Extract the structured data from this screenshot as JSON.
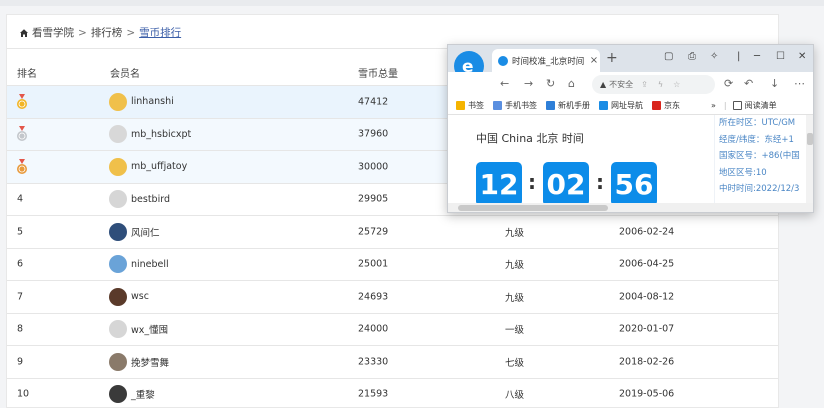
{
  "breadcrumb": {
    "home": "看雪学院",
    "sep": ">",
    "level2": "排行榜",
    "current": "雪币排行"
  },
  "table": {
    "headers": {
      "rank": "排名",
      "member": "会员名",
      "coins": "雪币总量"
    },
    "rows": [
      {
        "rank": "",
        "medal": "gold",
        "avatar": "#f0c04a",
        "name": "linhanshi",
        "coins": "47412",
        "level": "",
        "date": ""
      },
      {
        "rank": "",
        "medal": "silver",
        "avatar": "#d8d8d8",
        "name": "mb_hsbicxpt",
        "coins": "37960",
        "level": "",
        "date": ""
      },
      {
        "rank": "",
        "medal": "bronze",
        "avatar": "#f0c04a",
        "name": "mb_uffjatoy",
        "coins": "30000",
        "level": "",
        "date": ""
      },
      {
        "rank": "4",
        "medal": "",
        "avatar": "#d6d6d6",
        "name": "bestbird",
        "coins": "29905",
        "level": "",
        "date": ""
      },
      {
        "rank": "5",
        "medal": "",
        "avatar": "#2f4e7a",
        "name": "风间仁",
        "coins": "25729",
        "level": "九级",
        "date": "2006-02-24"
      },
      {
        "rank": "6",
        "medal": "",
        "avatar": "#6aa3d8",
        "name": "ninebell",
        "coins": "25001",
        "level": "九级",
        "date": "2006-04-25"
      },
      {
        "rank": "7",
        "medal": "",
        "avatar": "#5a3a2a",
        "name": "wsc",
        "coins": "24693",
        "level": "九级",
        "date": "2004-08-12"
      },
      {
        "rank": "8",
        "medal": "",
        "avatar": "#d6d6d6",
        "name": "wx_懂囤",
        "coins": "24000",
        "level": "一级",
        "date": "2020-01-07"
      },
      {
        "rank": "9",
        "medal": "",
        "avatar": "#8a7a6a",
        "name": "挽梦雪舞",
        "coins": "23330",
        "level": "七级",
        "date": "2018-02-26"
      },
      {
        "rank": "10",
        "medal": "",
        "avatar": "#3a3a3a",
        "name": "_重黎",
        "coins": "21593",
        "level": "八级",
        "date": "2019-05-06"
      }
    ]
  },
  "browser": {
    "tab_title": "时间校准_北京时间",
    "tab_close": "×",
    "new_tab": "+",
    "url_warning": "不安全",
    "bookmarks": [
      {
        "label": "书签",
        "color": "#f5b400"
      },
      {
        "label": "手机书签",
        "color": "#5a8fe0"
      },
      {
        "label": "新机手册",
        "color": "#2e7fd8"
      },
      {
        "label": "网址导航",
        "color": "#1a8ce5"
      },
      {
        "label": "京东",
        "color": "#d9251d"
      }
    ],
    "reading_list": "阅读清单",
    "more_bookmarks": "»",
    "location_label": "中国 China 北京 时间",
    "time": {
      "hh": "12",
      "mm": "02",
      "ss": "56",
      "sep": ":"
    },
    "side_info": [
      "所在时区：UTC/GM",
      "经度/纬度：东经+1",
      "国家区号：+86(中国",
      "地区区号:10",
      "中时时间:2022/12/3"
    ]
  }
}
